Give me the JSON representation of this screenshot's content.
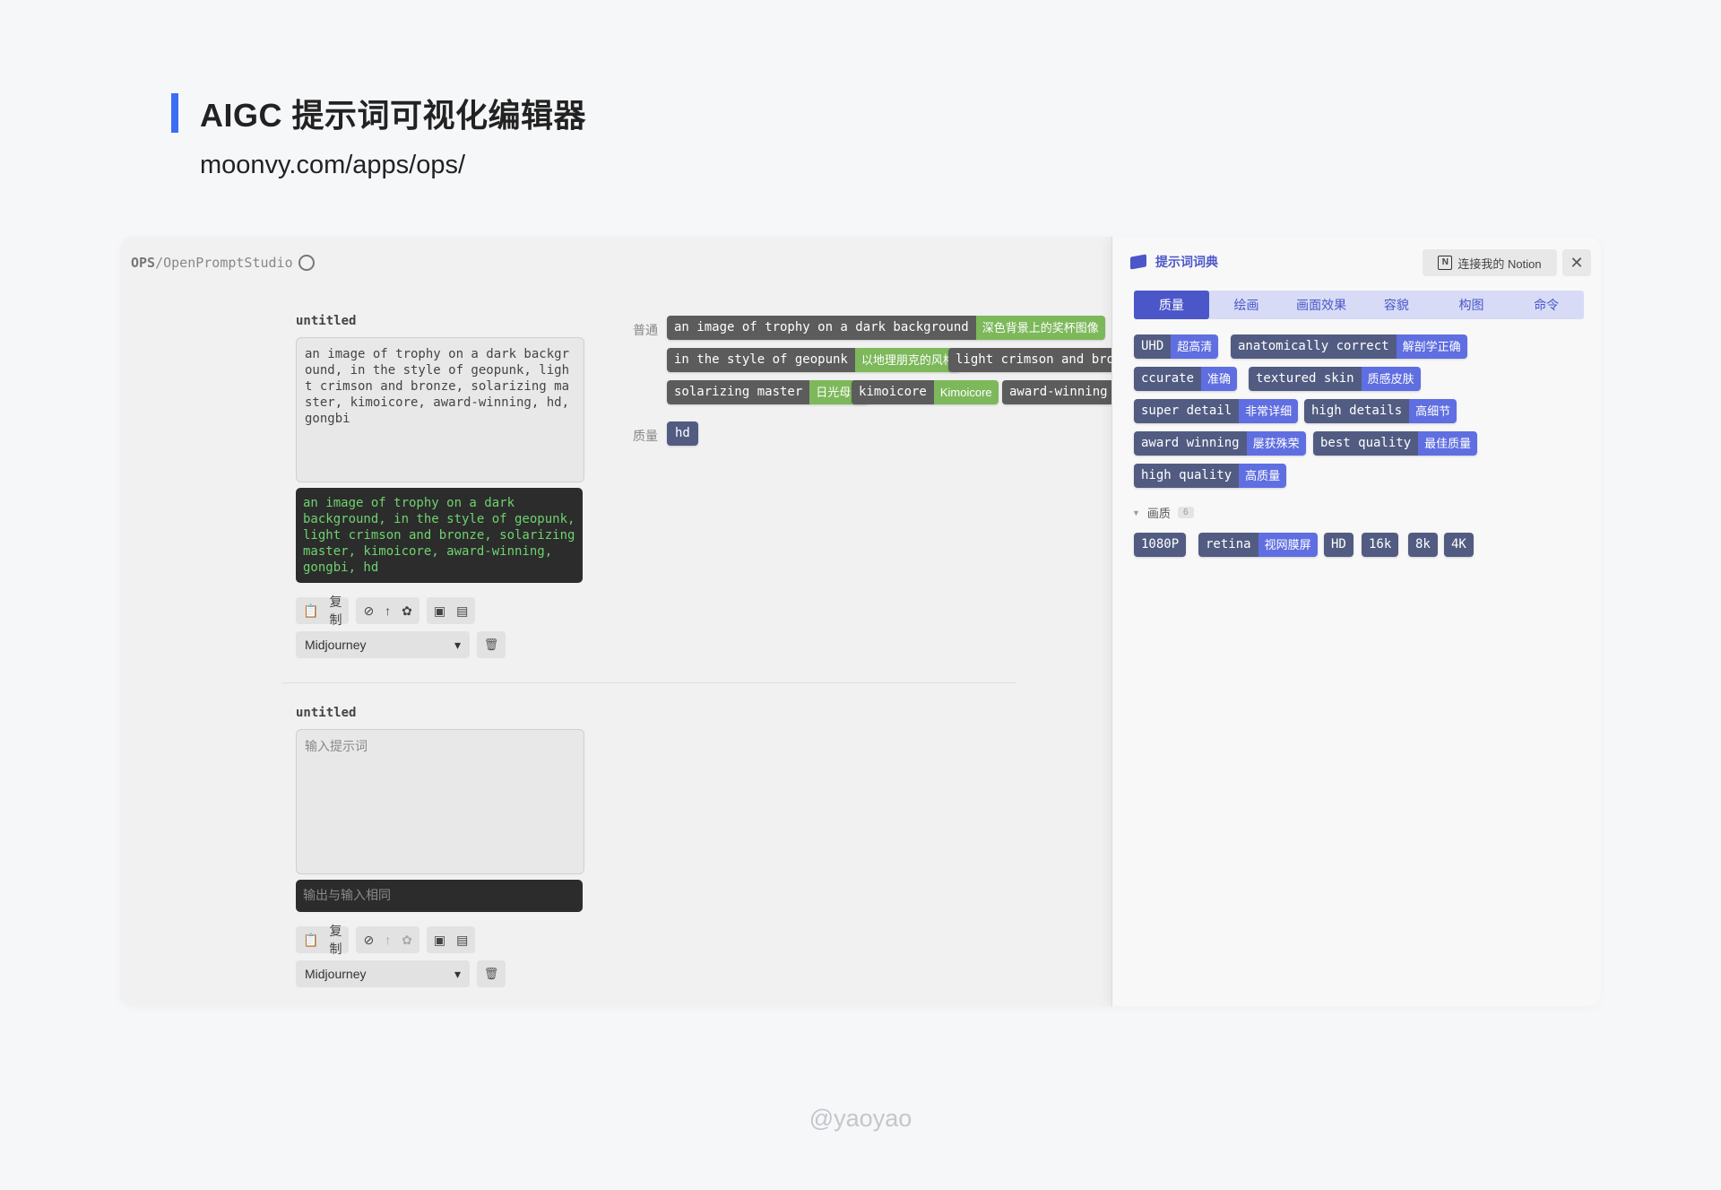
{
  "slide": {
    "title": "AIGC 提示词可视化编辑器",
    "url": "moonvy.com/apps/ops/",
    "footer": "@yaoyao"
  },
  "app": {
    "brand_bold": "OPS",
    "brand_rest": "/OpenPromptStudio",
    "brand_icon": "github-icon"
  },
  "editors": [
    {
      "title": "untitled",
      "input": "an image of trophy on a dark background, in the style of geopunk, light crimson and bronze, solarizing master, kimoicore, award-winning, hd, gongbi",
      "output": "an image of trophy on a dark background, in the style of geopunk, light crimson and bronze, solarizing master, kimoicore, award-winning, gongbi, hd",
      "copy_label": "复制",
      "model": "Midjourney"
    },
    {
      "title": "untitled",
      "input_placeholder": "输入提示词",
      "output_placeholder": "输出与输入相同",
      "copy_label": "复制",
      "model": "Midjourney"
    }
  ],
  "board": {
    "row_normal": "普通",
    "row_quality": "质量",
    "tags": [
      {
        "en": "an image of trophy on a dark background",
        "zh": "深色背景上的奖杯图像"
      },
      {
        "en": "in the style of geopunk",
        "zh": "以地理朋克的风格"
      },
      {
        "en": "light crimson and bronze",
        "zh": ""
      },
      {
        "en": "solarizing master",
        "zh": "日光母版"
      },
      {
        "en": "kimoicore",
        "zh": "Kimoicore"
      },
      {
        "en": "award-winning",
        "zh": ""
      }
    ],
    "quality_tag": "hd"
  },
  "drawer": {
    "title": "提示词词典",
    "notion_label": "连接我的 Notion",
    "close_icon": "close-icon",
    "tabs": [
      "质量",
      "绘画",
      "画面效果",
      "容貌",
      "构图",
      "命令"
    ],
    "active_tab": 0,
    "quality_tags": [
      {
        "en": "UHD",
        "zh": "超高清"
      },
      {
        "en": "anatomically correct",
        "zh": "解剖学正确"
      },
      {
        "en": "ccurate",
        "zh": "准确"
      },
      {
        "en": "textured skin",
        "zh": "质感皮肤"
      },
      {
        "en": "super detail",
        "zh": "非常详细"
      },
      {
        "en": "high details",
        "zh": "高细节"
      },
      {
        "en": "award winning",
        "zh": "屡获殊荣"
      },
      {
        "en": "best quality",
        "zh": "最佳质量"
      },
      {
        "en": "high quality",
        "zh": "高质量"
      }
    ],
    "group_name": "画质",
    "group_count": "6",
    "resolution_tags": [
      {
        "en": "1080P",
        "zh": ""
      },
      {
        "en": "retina",
        "zh": "视网膜屏"
      },
      {
        "en": "HD",
        "zh": ""
      },
      {
        "en": "16k",
        "zh": ""
      },
      {
        "en": "8k",
        "zh": ""
      },
      {
        "en": "4K",
        "zh": ""
      }
    ]
  },
  "colors": {
    "accent": "#3b6ef5",
    "tag_dark": "#5c5c5c",
    "tag_green": "#7db85b",
    "tag_navy": "#525c82",
    "tag_blue": "#5f6ee0",
    "drawer_accent": "#4b57c8"
  }
}
